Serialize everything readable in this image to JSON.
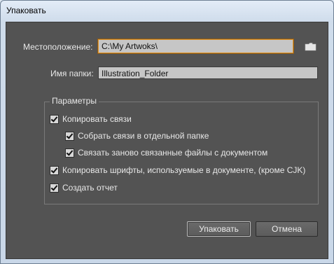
{
  "window": {
    "title": "Упаковать"
  },
  "location": {
    "label": "Местоположение:",
    "value": "C:\\My Artwoks\\"
  },
  "folder_name": {
    "label": "Имя папки:",
    "value": "Illustration_Folder"
  },
  "params": {
    "legend": "Параметры",
    "options": [
      {
        "label": "Копировать связи",
        "checked": true
      },
      {
        "label": "Собрать связи в отдельной папке",
        "checked": true
      },
      {
        "label": "Связать заново связанные файлы с документом",
        "checked": true
      },
      {
        "label": "Копировать шрифты, используемые в документе, (кроме CJK)",
        "checked": true
      },
      {
        "label": "Создать отчет",
        "checked": true
      }
    ]
  },
  "buttons": {
    "package": "Упаковать",
    "cancel": "Отмена"
  },
  "icons": {
    "browse": "folder-icon"
  },
  "colors": {
    "panel": "#535353",
    "focus_border": "#e0962d"
  }
}
